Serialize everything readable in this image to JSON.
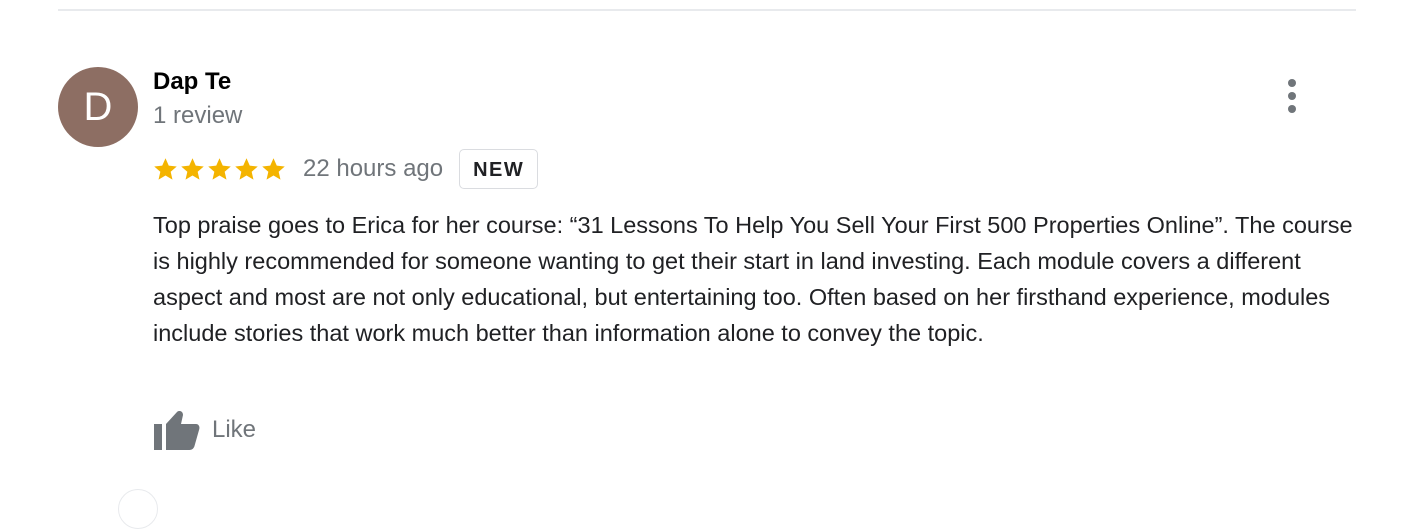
{
  "review": {
    "author": {
      "initial": "D",
      "name": "Dap Te",
      "review_count": "1 review",
      "avatar_color": "#8d6e63"
    },
    "rating": {
      "stars": 5,
      "max_stars": 5,
      "star_color": "#f4b400"
    },
    "time_ago": "22 hours ago",
    "badge": "NEW",
    "text": "Top praise goes to Erica for her course: “31 Lessons To Help You Sell Your First 500 Properties Online”. The course is highly recommended for someone wanting to get their start in land investing. Each module covers a different aspect and most are not only educational, but entertaining too. Often based on her firsthand experience, modules include stories that work much better than information alone to convey the topic.",
    "actions": {
      "like_label": "Like",
      "like_icon": "thumbs-up-icon",
      "more_icon": "more-vert-icon"
    }
  }
}
